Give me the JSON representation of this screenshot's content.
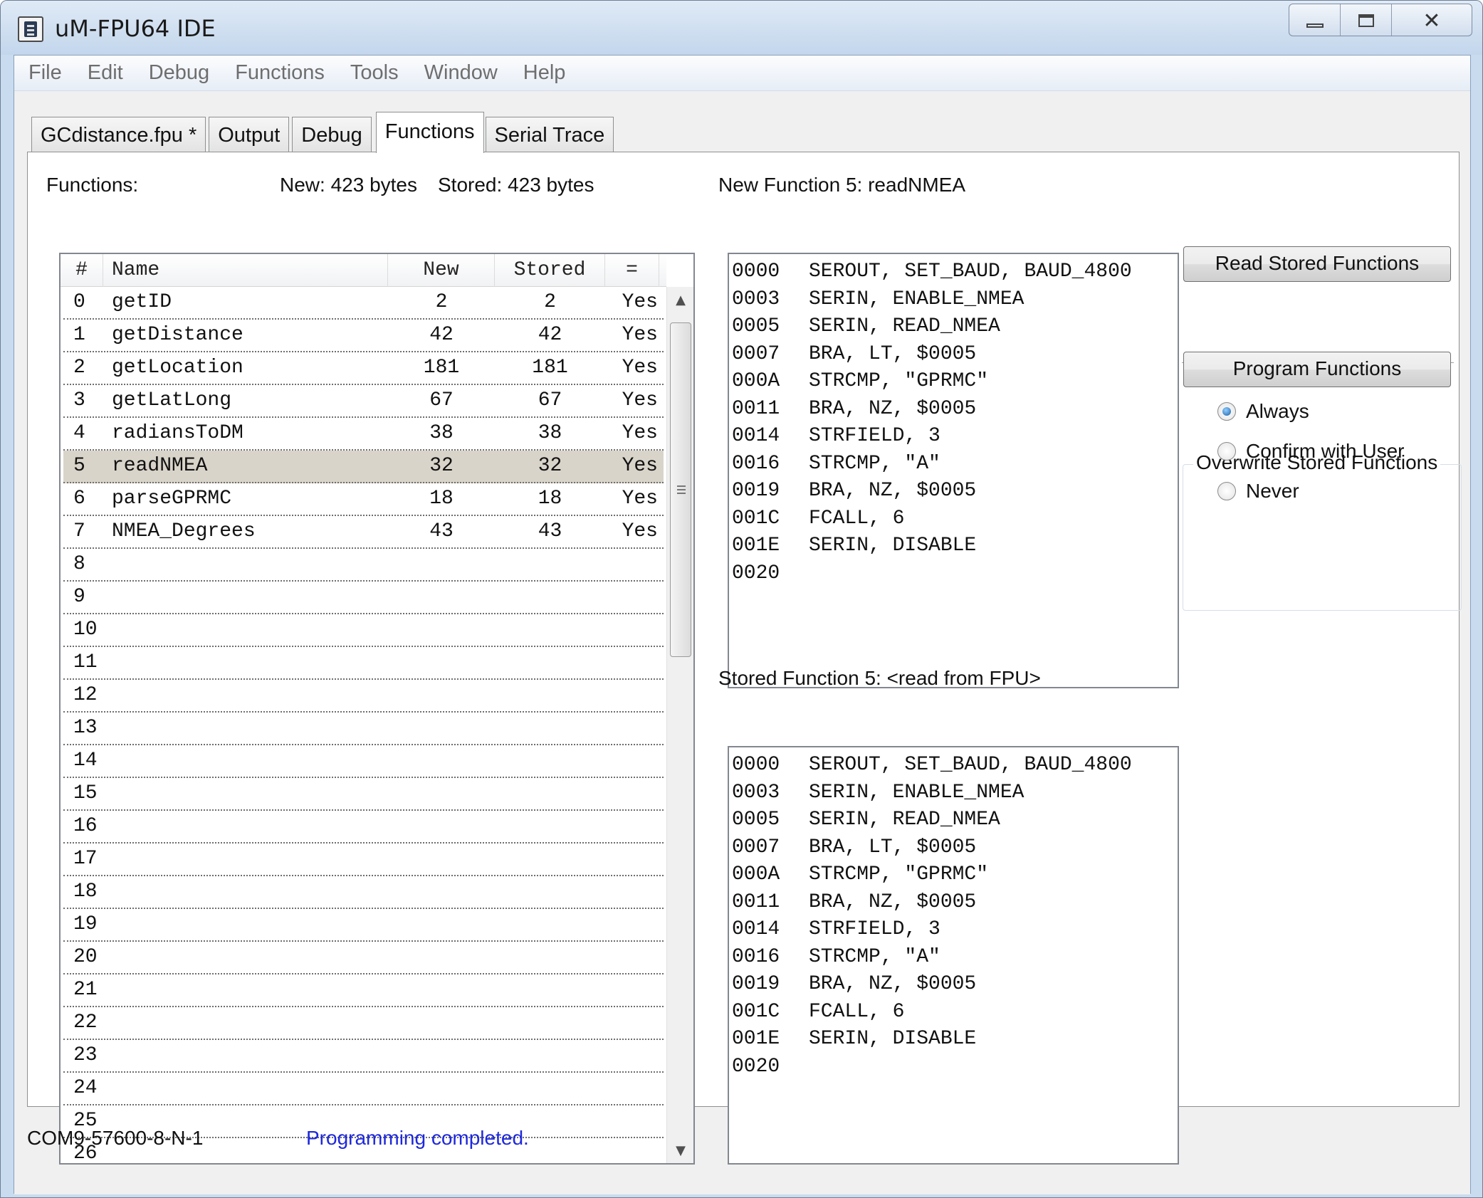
{
  "window": {
    "title": "uM-FPU64 IDE"
  },
  "menu": [
    "File",
    "Edit",
    "Debug",
    "Functions",
    "Tools",
    "Window",
    "Help"
  ],
  "tabs": [
    {
      "label": "GCdistance.fpu *",
      "active": false
    },
    {
      "label": "Output",
      "active": false
    },
    {
      "label": "Debug",
      "active": false
    },
    {
      "label": "Functions",
      "active": true
    },
    {
      "label": "Serial Trace",
      "active": false
    }
  ],
  "functions_panel": {
    "label": "Functions:",
    "new_bytes": "New: 423 bytes",
    "stored_bytes": "Stored: 423 bytes",
    "columns": [
      "#",
      "Name",
      "New",
      "Stored",
      "="
    ],
    "selected_index": 5,
    "rows": [
      {
        "num": "0",
        "name": "getID",
        "new": "2",
        "stored": "2",
        "eq": "Yes"
      },
      {
        "num": "1",
        "name": "getDistance",
        "new": "42",
        "stored": "42",
        "eq": "Yes"
      },
      {
        "num": "2",
        "name": "getLocation",
        "new": "181",
        "stored": "181",
        "eq": "Yes"
      },
      {
        "num": "3",
        "name": "getLatLong",
        "new": "67",
        "stored": "67",
        "eq": "Yes"
      },
      {
        "num": "4",
        "name": "radiansToDM",
        "new": "38",
        "stored": "38",
        "eq": "Yes"
      },
      {
        "num": "5",
        "name": "readNMEA",
        "new": "32",
        "stored": "32",
        "eq": "Yes"
      },
      {
        "num": "6",
        "name": "parseGPRMC",
        "new": "18",
        "stored": "18",
        "eq": "Yes"
      },
      {
        "num": "7",
        "name": "NMEA_Degrees",
        "new": "43",
        "stored": "43",
        "eq": "Yes"
      },
      {
        "num": "8",
        "name": "",
        "new": "",
        "stored": "",
        "eq": ""
      },
      {
        "num": "9",
        "name": "",
        "new": "",
        "stored": "",
        "eq": ""
      },
      {
        "num": "10",
        "name": "",
        "new": "",
        "stored": "",
        "eq": ""
      },
      {
        "num": "11",
        "name": "",
        "new": "",
        "stored": "",
        "eq": ""
      },
      {
        "num": "12",
        "name": "",
        "new": "",
        "stored": "",
        "eq": ""
      },
      {
        "num": "13",
        "name": "",
        "new": "",
        "stored": "",
        "eq": ""
      },
      {
        "num": "14",
        "name": "",
        "new": "",
        "stored": "",
        "eq": ""
      },
      {
        "num": "15",
        "name": "",
        "new": "",
        "stored": "",
        "eq": ""
      },
      {
        "num": "16",
        "name": "",
        "new": "",
        "stored": "",
        "eq": ""
      },
      {
        "num": "17",
        "name": "",
        "new": "",
        "stored": "",
        "eq": ""
      },
      {
        "num": "18",
        "name": "",
        "new": "",
        "stored": "",
        "eq": ""
      },
      {
        "num": "19",
        "name": "",
        "new": "",
        "stored": "",
        "eq": ""
      },
      {
        "num": "20",
        "name": "",
        "new": "",
        "stored": "",
        "eq": ""
      },
      {
        "num": "21",
        "name": "",
        "new": "",
        "stored": "",
        "eq": ""
      },
      {
        "num": "22",
        "name": "",
        "new": "",
        "stored": "",
        "eq": ""
      },
      {
        "num": "23",
        "name": "",
        "new": "",
        "stored": "",
        "eq": ""
      },
      {
        "num": "24",
        "name": "",
        "new": "",
        "stored": "",
        "eq": ""
      },
      {
        "num": "25",
        "name": "",
        "new": "",
        "stored": "",
        "eq": ""
      },
      {
        "num": "26",
        "name": "",
        "new": "",
        "stored": "",
        "eq": ""
      }
    ]
  },
  "new_function": {
    "label": "New Function 5: readNMEA",
    "lines": [
      {
        "addr": "0000",
        "code": "SEROUT, SET_BAUD, BAUD_4800"
      },
      {
        "addr": "0003",
        "code": "SERIN, ENABLE_NMEA"
      },
      {
        "addr": "0005",
        "code": "SERIN, READ_NMEA"
      },
      {
        "addr": "0007",
        "code": "BRA, LT, $0005"
      },
      {
        "addr": "000A",
        "code": "STRCMP, \"GPRMC\""
      },
      {
        "addr": "0011",
        "code": "BRA, NZ, $0005"
      },
      {
        "addr": "0014",
        "code": "STRFIELD, 3"
      },
      {
        "addr": "0016",
        "code": "STRCMP, \"A\""
      },
      {
        "addr": "0019",
        "code": "BRA, NZ, $0005"
      },
      {
        "addr": "001C",
        "code": "FCALL, 6"
      },
      {
        "addr": "001E",
        "code": "SERIN, DISABLE"
      },
      {
        "addr": "0020",
        "code": ""
      }
    ]
  },
  "stored_function": {
    "label": "Stored Function 5: <read from FPU>",
    "lines": [
      {
        "addr": "0000",
        "code": "SEROUT, SET_BAUD, BAUD_4800"
      },
      {
        "addr": "0003",
        "code": "SERIN, ENABLE_NMEA"
      },
      {
        "addr": "0005",
        "code": "SERIN, READ_NMEA"
      },
      {
        "addr": "0007",
        "code": "BRA, LT, $0005"
      },
      {
        "addr": "000A",
        "code": "STRCMP, \"GPRMC\""
      },
      {
        "addr": "0011",
        "code": "BRA, NZ, $0005"
      },
      {
        "addr": "0014",
        "code": "STRFIELD, 3"
      },
      {
        "addr": "0016",
        "code": "STRCMP, \"A\""
      },
      {
        "addr": "0019",
        "code": "BRA, NZ, $0005"
      },
      {
        "addr": "001C",
        "code": "FCALL, 6"
      },
      {
        "addr": "001E",
        "code": "SERIN, DISABLE"
      },
      {
        "addr": "0020",
        "code": ""
      }
    ]
  },
  "buttons": {
    "read_stored": "Read Stored Functions",
    "program": "Program Functions"
  },
  "overwrite": {
    "title": "Overwrite Stored Functions",
    "options": [
      {
        "label": "Always",
        "checked": true
      },
      {
        "label": "Confirm with User",
        "checked": false
      },
      {
        "label": "Never",
        "checked": false
      }
    ]
  },
  "status": {
    "port": "COM9-57600-8-N-1",
    "message": "Programming completed.",
    "message_color": "#1e28dc"
  },
  "icons": {
    "window": [
      "app-icon",
      "minimize-icon",
      "maximize-icon",
      "close-icon"
    ],
    "scrollbar": [
      "scroll-up-arrow-icon",
      "scroll-down-arrow-icon"
    ]
  }
}
